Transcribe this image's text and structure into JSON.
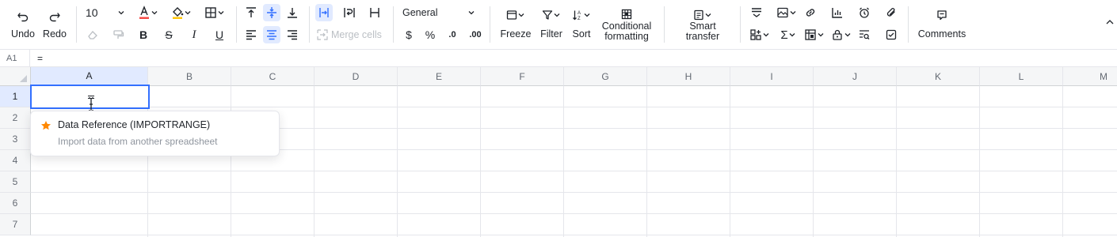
{
  "toolbar": {
    "undo": "Undo",
    "redo": "Redo",
    "font_size": "10",
    "merge_cells": "Merge cells",
    "number_format": "General",
    "dollar": "$",
    "percent": "%",
    "dec_decrease": ".0",
    "dec_increase": ".00",
    "freeze": "Freeze",
    "filter": "Filter",
    "sort": "Sort",
    "conditional_line1": "Conditional",
    "conditional_line2": "formatting",
    "smart_line1": "Smart",
    "smart_line2": "transfer",
    "comments": "Comments",
    "bold": "B",
    "strike": "S",
    "italic": "I",
    "underline": "U",
    "colors": {
      "accent": "#3370ff",
      "font_color_bar": "#f54a45",
      "fill_color_bar": "#ffc60a"
    }
  },
  "formula_bar": {
    "cell_ref": "A1",
    "content": "="
  },
  "grid": {
    "columns": [
      "A",
      "B",
      "C",
      "D",
      "E",
      "F",
      "G",
      "H",
      "I",
      "J",
      "K",
      "L",
      "M"
    ],
    "rows": [
      "1",
      "2",
      "3",
      "4",
      "5",
      "6",
      "7"
    ],
    "selected_cell": "A1"
  },
  "autocomplete": {
    "title": "Data Reference (IMPORTRANGE)",
    "description": "Import data from another spreadsheet",
    "icon": "star-icon",
    "icon_color": "#ff8800"
  }
}
